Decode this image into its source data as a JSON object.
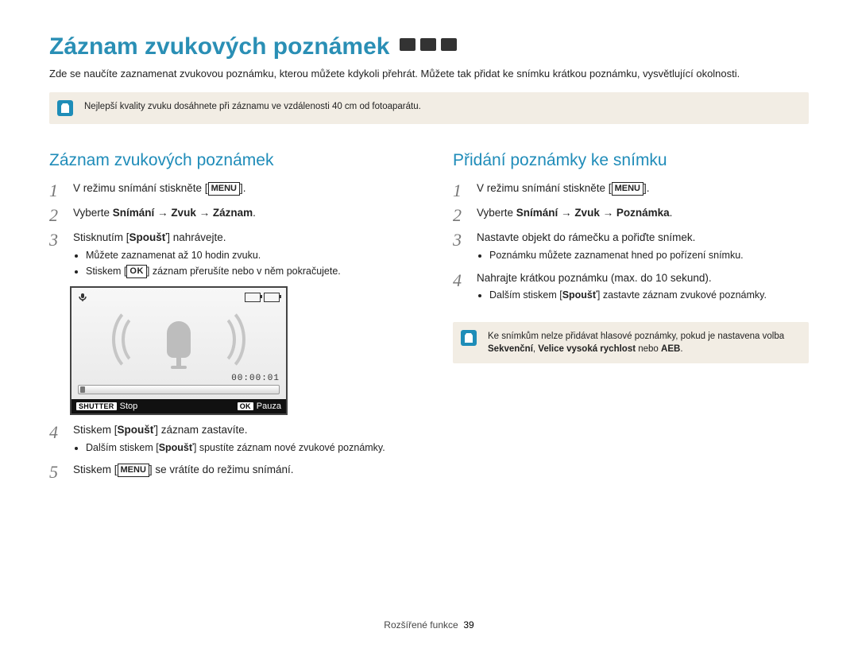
{
  "title": "Záznam zvukových poznámek",
  "lead": "Zde se naučíte zaznamenat zvukovou poznámku, kterou můžete kdykoli přehrát. Můžete tak přidat ke snímku krátkou poznámku, vysvětlující okolnosti.",
  "top_note": "Nejlepší kvality zvuku dosáhnete při záznamu ve vzdálenosti 40 cm od fotoaparátu.",
  "buttons": {
    "menu": "MENU",
    "ok": "OK",
    "shutter": "SHUTTER",
    "ok_short": "OK"
  },
  "left": {
    "heading": "Záznam zvukových poznámek",
    "steps": {
      "s1": {
        "pre": "V režimu snímání stiskněte [",
        "post": "]."
      },
      "s2": {
        "pre": "Vyberte ",
        "b1": "Snímání",
        "arrow": " → ",
        "b2": "Zvuk",
        "b3": "Záznam",
        "post": "."
      },
      "s3": {
        "pre": "Stisknutím [",
        "b": "Spoušť",
        "post": "] nahrávejte.",
        "bullet1": "Můžete zaznamenat až 10 hodin zvuku.",
        "bullet2_pre": "Stiskem [",
        "bullet2_post": "] záznam přerušíte nebo v něm pokračujete."
      },
      "s4": {
        "pre": "Stiskem [",
        "b": "Spoušť",
        "post": "] záznam zastavíte.",
        "bullet_pre": "Dalším stiskem [",
        "bullet_b": "Spoušť",
        "bullet_post": "] spustíte záznam nové zvukové poznámky."
      },
      "s5": {
        "pre": "Stiskem [",
        "post": "] se vrátíte do režimu snímání."
      }
    },
    "recorder": {
      "time": "00:00:01",
      "stop": "Stop",
      "pause": "Pauza"
    }
  },
  "right": {
    "heading": "Přidání poznámky ke snímku",
    "steps": {
      "s1": {
        "pre": "V režimu snímání stiskněte [",
        "post": "]."
      },
      "s2": {
        "pre": "Vyberte ",
        "b1": "Snímání",
        "arrow": " → ",
        "b2": "Zvuk",
        "b3": "Poznámka",
        "post": "."
      },
      "s3": {
        "text": "Nastavte objekt do rámečku a pořiďte snímek.",
        "bullet": "Poznámku můžete zaznamenat hned po pořízení snímku."
      },
      "s4": {
        "text": "Nahrajte krátkou poznámku (max. do 10 sekund).",
        "bullet_pre": "Dalším stiskem [",
        "bullet_b": "Spoušť",
        "bullet_post": "] zastavte záznam zvukové poznámky."
      }
    },
    "note_pre": "Ke snímkům nelze přidávat hlasové poznámky, pokud je nastavena volba ",
    "note_b1": "Sekvenční",
    "note_mid": ", ",
    "note_b2": "Velice vysoká rychlost",
    "note_mid2": " nebo ",
    "note_b3": "AEB",
    "note_post": "."
  },
  "footer": {
    "section": "Rozšířené funkce",
    "page": "39"
  }
}
